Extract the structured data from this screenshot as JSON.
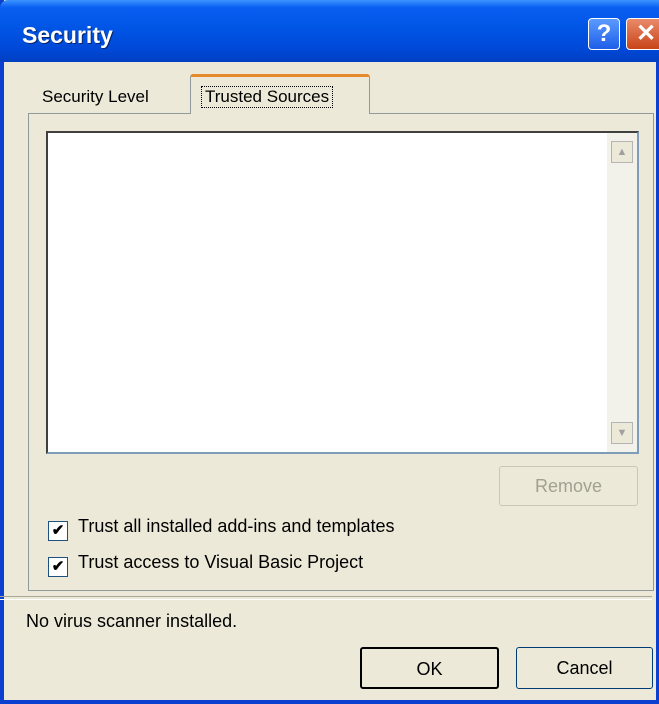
{
  "window": {
    "title": "Security"
  },
  "titlebar": {
    "help_glyph": "?",
    "close_glyph": "✕"
  },
  "tabs": [
    {
      "label": "Security Level",
      "selected": false
    },
    {
      "label": "Trusted Sources",
      "selected": true
    }
  ],
  "trusted_sources": {
    "items": [],
    "remove_label": "Remove",
    "remove_enabled": false
  },
  "scrollbar": {
    "up_glyph": "▲",
    "down_glyph": "▼"
  },
  "options": [
    {
      "label": "Trust all installed add-ins and templates",
      "checked": true
    },
    {
      "label": "Trust access to Visual Basic Project",
      "checked": true
    }
  ],
  "checkmark": "✔",
  "status": {
    "text": "No virus scanner installed."
  },
  "buttons": {
    "ok": "OK",
    "cancel": "Cancel"
  },
  "colors": {
    "titlebar": "#0055e5",
    "face": "#ece9d8",
    "selected_tab_accent": "#e68b2c"
  }
}
